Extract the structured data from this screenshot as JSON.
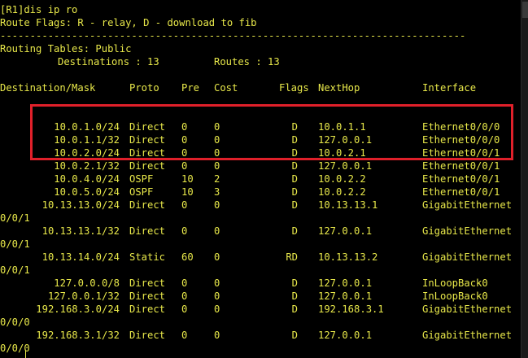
{
  "prompt": "[R1]dis ip ro",
  "route_flags": "Route Flags: R - relay, D - download to fib",
  "separator": "------------------------------------------------------------------------------",
  "routing_tables": "Routing Tables: Public",
  "summary": {
    "destinations_label": "Destinations : 13",
    "routes_label": "Routes : 13"
  },
  "headers": {
    "destination": "Destination/Mask",
    "proto": "Proto",
    "pre": "Pre",
    "cost": "Cost",
    "flags": "Flags",
    "nexthop": "NextHop",
    "interface": "Interface"
  },
  "routes": [
    {
      "dest": "10.0.1.0/24",
      "proto": "Direct",
      "pre": "0",
      "cost": "0",
      "flags": "D",
      "nexthop": "10.0.1.1",
      "iface": "Ethernet0/0/0",
      "iface_wrap": ""
    },
    {
      "dest": "10.0.1.1/32",
      "proto": "Direct",
      "pre": "0",
      "cost": "0",
      "flags": "D",
      "nexthop": "127.0.0.1",
      "iface": "Ethernet0/0/0",
      "iface_wrap": ""
    },
    {
      "dest": "10.0.2.0/24",
      "proto": "Direct",
      "pre": "0",
      "cost": "0",
      "flags": "D",
      "nexthop": "10.0.2.1",
      "iface": "Ethernet0/0/1",
      "iface_wrap": ""
    },
    {
      "dest": "10.0.2.1/32",
      "proto": "Direct",
      "pre": "0",
      "cost": "0",
      "flags": "D",
      "nexthop": "127.0.0.1",
      "iface": "Ethernet0/0/1",
      "iface_wrap": ""
    },
    {
      "dest": "10.0.4.0/24",
      "proto": "OSPF",
      "pre": "10",
      "cost": "2",
      "flags": "D",
      "nexthop": "10.0.2.2",
      "iface": "Ethernet0/0/1",
      "iface_wrap": ""
    },
    {
      "dest": "10.0.5.0/24",
      "proto": "OSPF",
      "pre": "10",
      "cost": "3",
      "flags": "D",
      "nexthop": "10.0.2.2",
      "iface": "Ethernet0/0/1",
      "iface_wrap": ""
    },
    {
      "dest": "10.13.13.0/24",
      "proto": "Direct",
      "pre": "0",
      "cost": "0",
      "flags": "D",
      "nexthop": "10.13.13.1",
      "iface": "GigabitEthernet",
      "iface_wrap": "0/0/1"
    },
    {
      "dest": "10.13.13.1/32",
      "proto": "Direct",
      "pre": "0",
      "cost": "0",
      "flags": "D",
      "nexthop": "127.0.0.1",
      "iface": "GigabitEthernet",
      "iface_wrap": "0/0/1"
    },
    {
      "dest": "10.13.14.0/24",
      "proto": "Static",
      "pre": "60",
      "cost": "0",
      "flags": "RD",
      "nexthop": "10.13.13.2",
      "iface": "GigabitEthernet",
      "iface_wrap": "0/0/1"
    },
    {
      "dest": "127.0.0.0/8",
      "proto": "Direct",
      "pre": "0",
      "cost": "0",
      "flags": "D",
      "nexthop": "127.0.0.1",
      "iface": "InLoopBack0",
      "iface_wrap": ""
    },
    {
      "dest": "127.0.0.1/32",
      "proto": "Direct",
      "pre": "0",
      "cost": "0",
      "flags": "D",
      "nexthop": "127.0.0.1",
      "iface": "InLoopBack0",
      "iface_wrap": ""
    },
    {
      "dest": "192.168.3.0/24",
      "proto": "Direct",
      "pre": "0",
      "cost": "0",
      "flags": "D",
      "nexthop": "192.168.3.1",
      "iface": "GigabitEthernet",
      "iface_wrap": "0/0/0"
    },
    {
      "dest": "192.168.3.1/32",
      "proto": "Direct",
      "pre": "0",
      "cost": "0",
      "flags": "D",
      "nexthop": "127.0.0.1",
      "iface": "GigabitEthernet",
      "iface_wrap": "0/0/0"
    }
  ],
  "colors": {
    "text": "#e8e84a",
    "background": "#000000",
    "highlight_border": "#e0202a"
  }
}
